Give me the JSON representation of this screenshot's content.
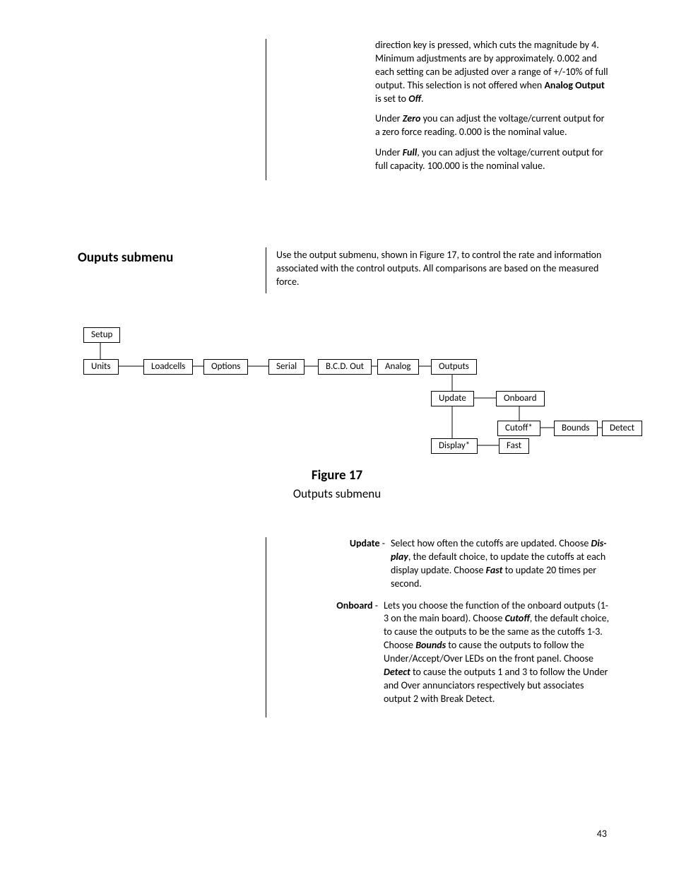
{
  "top_block": {
    "p1_pre": "direction key is pressed, which cuts the magnitude by 4. Minimum adjustments are by approximately. 0.002 and each setting can be adjusted over a range of +/-10% of full output. This selection is not offered when ",
    "p1_b1": "Analog Output",
    "p1_mid": " is set to ",
    "p1_b2": "Off",
    "p1_post": ".",
    "p2_pre": "Under ",
    "p2_b": "Zero",
    "p2_post": " you can adjust the voltage/current output for a zero force reading. 0.000 is the nominal value.",
    "p3_pre": "Under ",
    "p3_b": "Full",
    "p3_post": ", you can adjust the voltage/current output for full capacity. 100.000 is the nominal value."
  },
  "section": {
    "heading": "Ouputs submenu",
    "body": "Use the output submenu, shown in Figure 17, to control the rate and information associated with the control outputs. All comparisons are based on the measured force."
  },
  "diagram": {
    "nodes": {
      "setup": "Setup",
      "units": "Units",
      "loadcells": "Loadcells",
      "options": "Options",
      "serial": "Serial",
      "bcd": "B.C.D. Out",
      "analog": "Analog",
      "outputs": "Outputs",
      "update": "Update",
      "onboard": "Onboard",
      "cutoff": "Cutoff*",
      "bounds": "Bounds",
      "detect": "Detect",
      "display": "Display*",
      "fast": "Fast"
    }
  },
  "figure": {
    "number": "Figure 17",
    "title": "Outputs submenu"
  },
  "defs": {
    "update": {
      "term": "Update",
      "body_pre": "Select how often the cutoffs are updated. Choose ",
      "body_b1": "Dis­play",
      "body_mid1": ", the default choice, to update the cutoffs at each display update. Choose ",
      "body_b2": "Fast",
      "body_post": " to update 20 times per second."
    },
    "onboard": {
      "term": "Onboard",
      "body_pre": "Lets you choose the function of the onboard outputs (1-3 on the main board). Choose ",
      "body_b1": "Cutoff",
      "body_mid1": ", the default choice, to cause the outputs to be the same as the cutoffs 1-3. Choose ",
      "body_b2": "Bounds",
      "body_mid2": " to cause the outputs to follow the Under/Accept/Over LEDs on the front panel. Choose ",
      "body_b3": "Detect",
      "body_post": " to cause the outputs 1 and 3 to follow the Under and Over annunciators respectively but associates output 2 with Break Detect."
    }
  },
  "page_number": "43"
}
